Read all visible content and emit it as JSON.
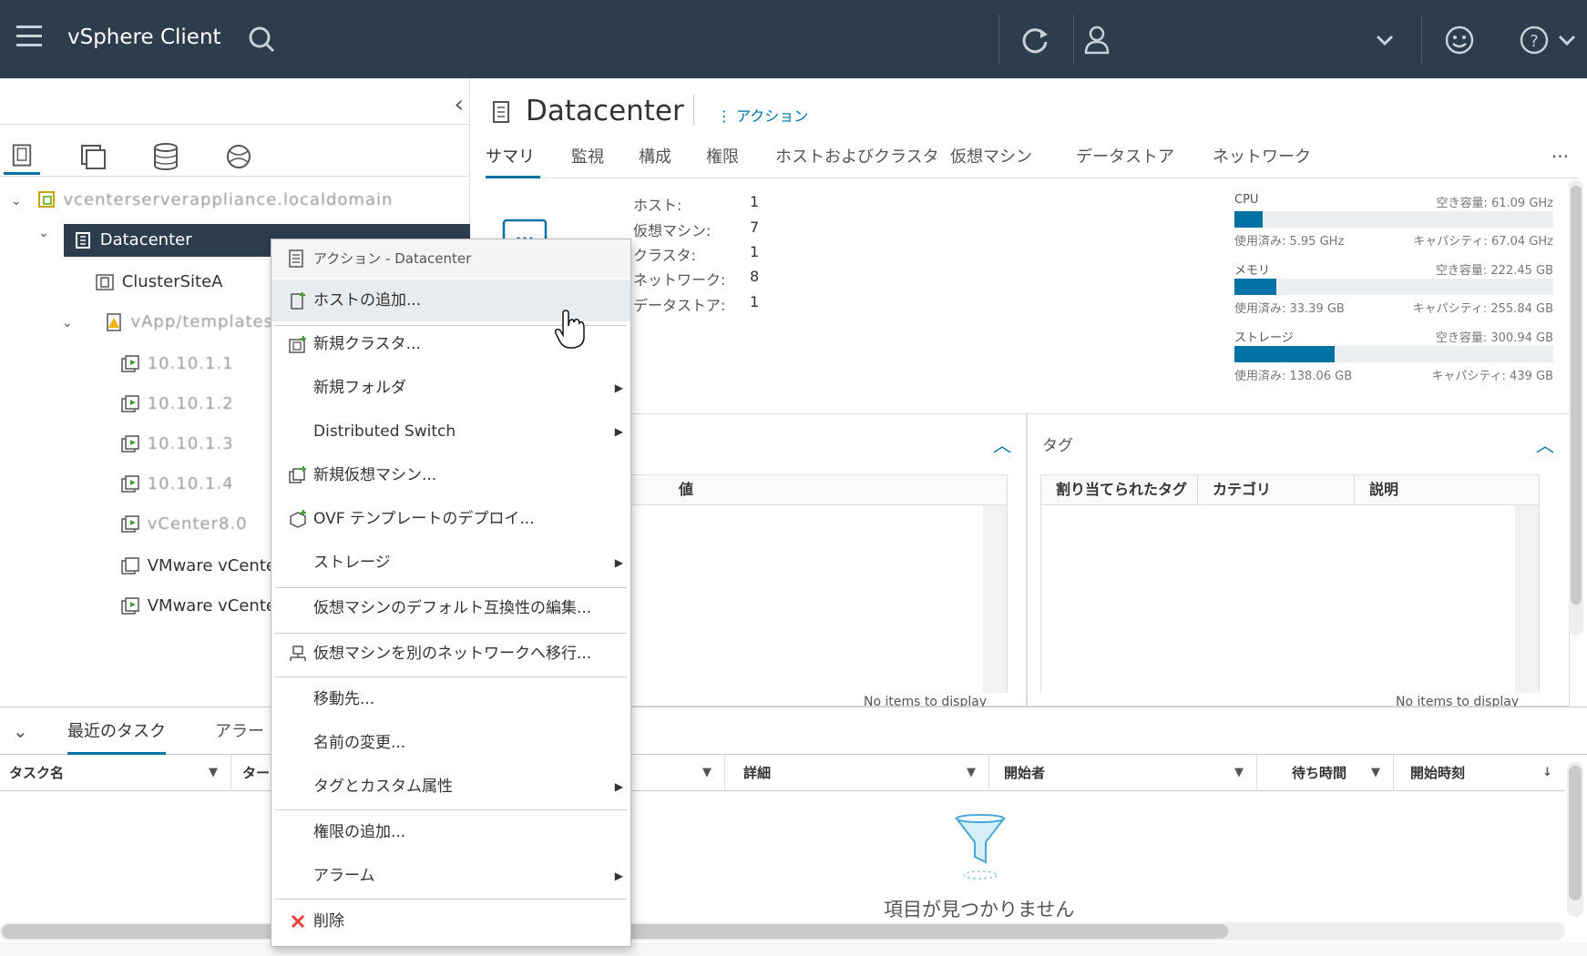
{
  "header": {
    "app_title": "vSphere Client",
    "icons": [
      "menu-icon",
      "search-icon",
      "refresh-icon",
      "user-icon",
      "chevron-down-icon",
      "smiley-icon",
      "help-icon"
    ]
  },
  "navigator": {
    "tree": [
      {
        "label": "vcenterserverappliance.localdomain"
      },
      {
        "label": "Datacenter"
      },
      {
        "label": "ClusterSiteA"
      },
      {
        "label": "vApp/templates"
      },
      {
        "label": "10.10.1.1"
      },
      {
        "label": "10.10.1.2"
      },
      {
        "label": "10.10.1.3"
      },
      {
        "label": "10.10.1.4"
      },
      {
        "label": "vCenter8.0"
      },
      {
        "label": "VMware vCente"
      },
      {
        "label": "VMware vCente"
      }
    ]
  },
  "main": {
    "title": "Datacenter",
    "actions_label": "アクション",
    "tabs": [
      "サマリ",
      "監視",
      "構成",
      "権限",
      "ホストおよびクラスタ",
      "仮想マシン",
      "データストア",
      "ネットワーク"
    ],
    "stats": [
      {
        "label": "ホスト:",
        "value": "1"
      },
      {
        "label": "仮想マシン:",
        "value": "7"
      },
      {
        "label": "クラスタ:",
        "value": "1"
      },
      {
        "label": "ネットワーク:",
        "value": "8"
      },
      {
        "label": "データストア:",
        "value": "1"
      }
    ],
    "resources": [
      {
        "name": "CPU",
        "free": "空き容量: 61.09 GHz",
        "used": "使用済み: 5.95 GHz",
        "capacity": "キャパシティ: 67.04 GHz",
        "fraction": 0.089
      },
      {
        "name": "メモリ",
        "free": "空き容量: 222.45 GB",
        "used": "使用済み: 33.39 GB",
        "capacity": "キャパシティ: 255.84 GB",
        "fraction": 0.13
      },
      {
        "name": "ストレージ",
        "free": "空き容量: 300.94 GB",
        "used": "使用済み: 138.06 GB",
        "capacity": "キャパシティ: 439 GB",
        "fraction": 0.314
      }
    ],
    "attributes_card": {
      "value_col": "値",
      "footer": "No items to display"
    },
    "tags_card": {
      "title": "タグ",
      "columns": [
        "割り当てられたタグ",
        "カテゴリ",
        "説明"
      ],
      "footer": "No items to display"
    }
  },
  "context_menu": {
    "header": "アクション - Datacenter",
    "items": [
      {
        "label": "ホストの追加..."
      },
      {
        "label": "新規クラスタ..."
      },
      {
        "label": "新規フォルダ"
      },
      {
        "label": "Distributed Switch"
      },
      {
        "label": "新規仮想マシン..."
      },
      {
        "label": "OVF テンプレートのデプロイ..."
      },
      {
        "label": "ストレージ"
      },
      {
        "label": "仮想マシンのデフォルト互換性の編集..."
      },
      {
        "label": "仮想マシンを別のネットワークへ移行..."
      },
      {
        "label": "移動先..."
      },
      {
        "label": "名前の変更..."
      },
      {
        "label": "タグとカスタム属性"
      },
      {
        "label": "権限の追加..."
      },
      {
        "label": "アラーム"
      },
      {
        "label": "削除"
      }
    ]
  },
  "tasks": {
    "tabs": [
      "最近のタスク",
      "アラー"
    ],
    "columns": [
      "タスク名",
      "ター",
      "詳細",
      "開始者",
      "待ち時間",
      "開始時刻"
    ],
    "empty_text": "項目が見つかりません"
  },
  "colors": {
    "header_bg": "#2e3d4e",
    "accent": "#0072a3",
    "selected_bg": "#2e3d4e",
    "delete_icon": "#e8413c"
  }
}
